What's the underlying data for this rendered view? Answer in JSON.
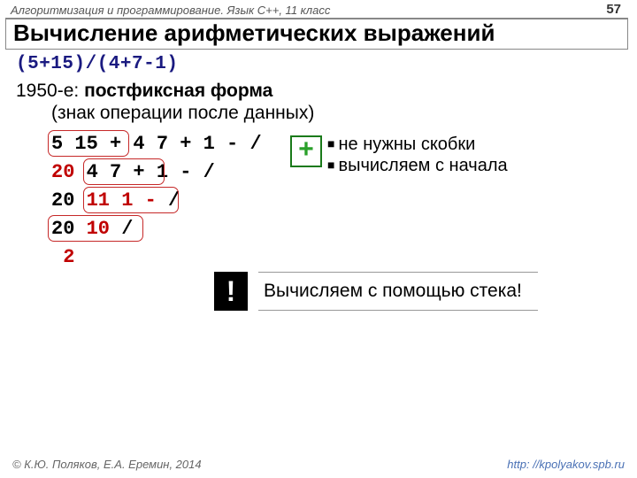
{
  "header": {
    "course": "Алгоритмизация и программирование. Язык C++, 11 класс",
    "page": "57"
  },
  "title": "Вычисление арифметических выражений",
  "expression": "(5+15)/(4+7-1)",
  "intro": {
    "year": "1950-е: ",
    "term": "постфиксная форма",
    "sub": "(знак операции после данных)"
  },
  "rows": {
    "r1a": "5 15 +",
    "r1b": " 4 7 + 1 - /",
    "r2a": "20",
    "r2b": " 4 7 + ",
    "r2c": "1 - /",
    "r3a": "20",
    "r3b": " 11 1 - ",
    "r3c": "/",
    "r4a": "20",
    "r4b": " 10 ",
    "r4c": "/",
    "r5": " 2"
  },
  "bullets": {
    "b1": "не нужны скобки",
    "b2": "вычисляем с начала"
  },
  "note": "Вычисляем с помощью стека!",
  "footer": {
    "left": "© К.Ю. Поляков, Е.А. Еремин, 2014",
    "right": "http: //kpolyakov.spb.ru"
  }
}
